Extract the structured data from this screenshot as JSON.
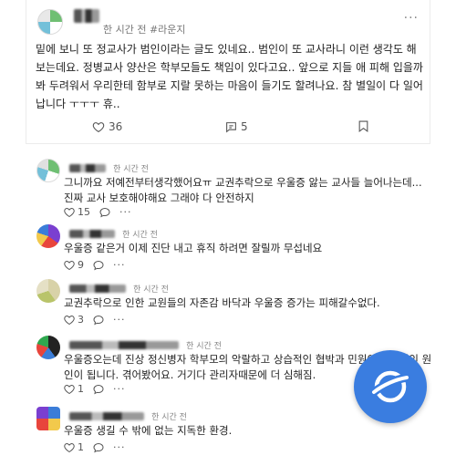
{
  "post": {
    "meta": "한 시간 전 #라운지",
    "body": "밑에 보니 또 정교사가 범인이라는 글도 있네요.. 범인이 또 교사라니 이런 생각도 해보는데요. 정병교사 양산은 학부모들도 책임이 있다고요.. 앞으로 지들 애 피해 입을까봐 두려워서 우리한테 함부로 지랄 못하는 마음이 들기도 할려나요. 참 별일이 다 일어납니다 ㅜㅜㅜ 휴..",
    "likes": "36",
    "comments": "5",
    "more": "···"
  },
  "comments": [
    {
      "time": "한 시간 전",
      "text": "그니까요 저예전부터생각했어요ㅠ 교권추락으로 우울증 앓는 교사들 늘어나는데... 진짜 교사 보호해야해요 그래야 다 안전하지",
      "likes": "15",
      "more": "···"
    },
    {
      "time": "한 시간 전",
      "text": "우울증 같은거 이제 진단 내고 휴직 하려면 잘릴까 무섭네요",
      "likes": "9",
      "more": "···"
    },
    {
      "time": "한 시간 전",
      "text": "교권추락으로 인한 교원들의 자존감 바닥과 우울증 증가는 피해갈수없다.",
      "likes": "3",
      "more": "···"
    },
    {
      "time": "한 시간 전",
      "text": "우울증오는데 진상 정신병자 학부모의 악랄하고 상습적인 협박과 민원이 결정적인 원인이 됩니다. 겪어봤어요. 거기다 관리자때문에 더 심해짐.",
      "likes": "1",
      "more": "···"
    },
    {
      "time": "한 시간 전",
      "text": "우울증 생길 수 밖에 없는 지독한 환경.",
      "likes": "1",
      "more": "···"
    }
  ],
  "colors": {
    "fab": "#3a7de0",
    "text": "#222222",
    "muted": "#777777"
  },
  "icons": [
    "heart-icon",
    "comment-icon",
    "bookmark-icon",
    "more-icon",
    "app-logo-icon"
  ]
}
